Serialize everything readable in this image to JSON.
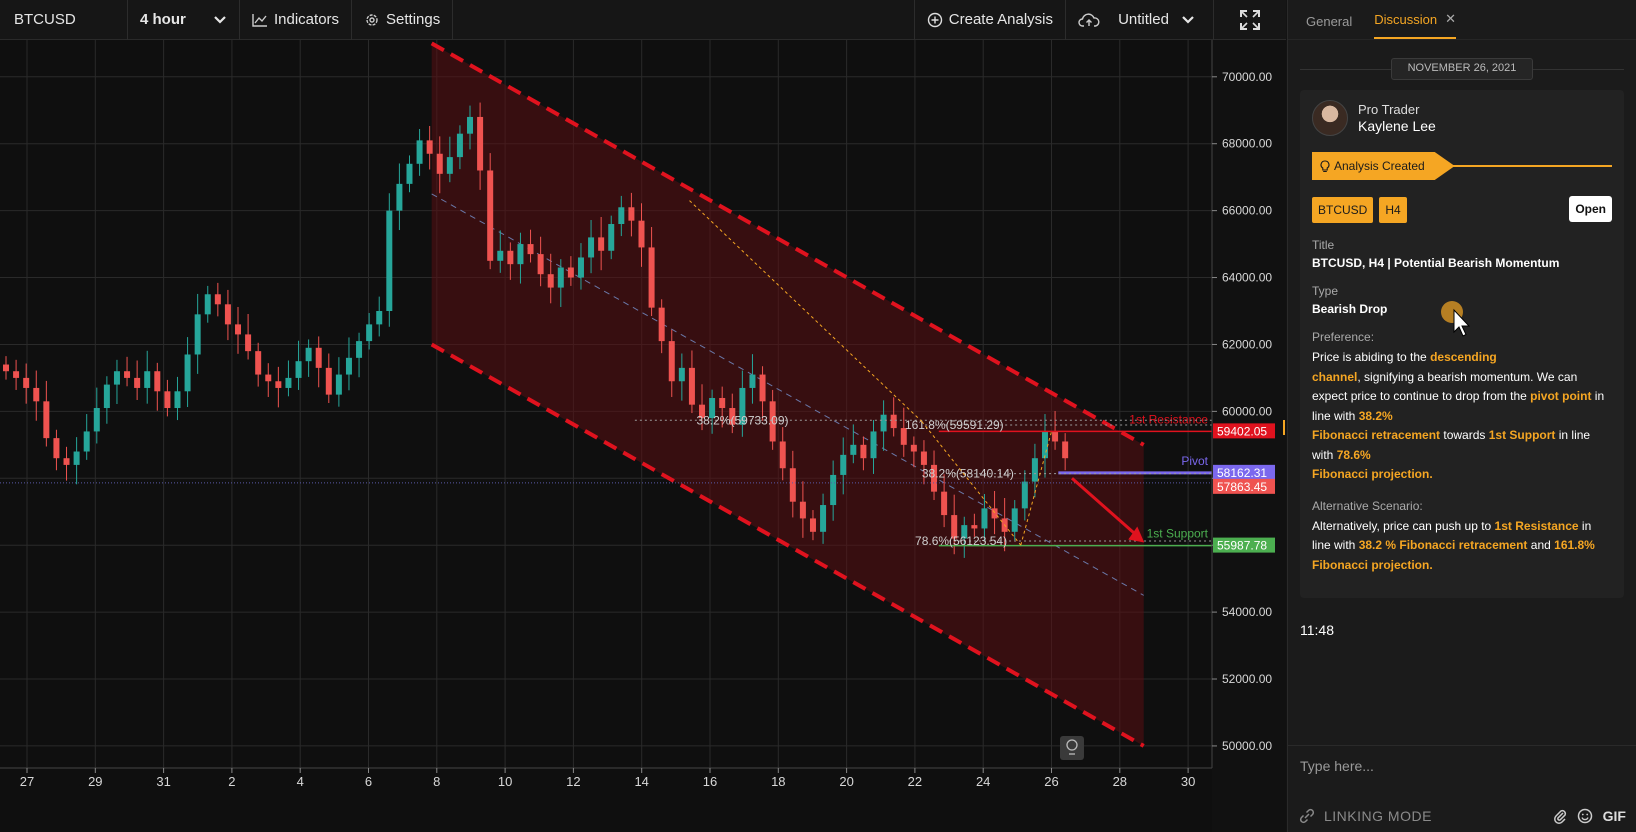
{
  "toolbar": {
    "symbol": "BTCUSD",
    "interval": "4 hour",
    "indicators": "Indicators",
    "settings": "Settings",
    "create_analysis": "Create Analysis",
    "layout_name": "Untitled"
  },
  "icons": {
    "interval_dropdown": "chevron-down-icon",
    "indicators": "line-chart-icon",
    "settings": "gear-icon",
    "create": "plus-circle-icon",
    "cloud": "cloud-upload-icon",
    "layout_dropdown": "chevron-down-icon",
    "fullscreen": "expand-icon",
    "idea": "lightbulb-icon",
    "linking": "link-icon",
    "attach": "paperclip-icon",
    "emoji": "emoji-icon"
  },
  "colors": {
    "accent": "#f5a623",
    "bull": "#26a69a",
    "bear": "#ef5350",
    "channel": "#e0121e",
    "support": "#4caf50",
    "pivot": "#7b68ee"
  },
  "chart_data": {
    "type": "candlestick",
    "x_ticks": [
      "27",
      "29",
      "31",
      "2",
      "4",
      "6",
      "8",
      "10",
      "12",
      "14",
      "16",
      "18",
      "20",
      "22",
      "24",
      "26",
      "28",
      "30"
    ],
    "y_ticks": [
      "70000.00",
      "68000.00",
      "66000.00",
      "64000.00",
      "62000.00",
      "60000.00",
      "58000.00",
      "56000.00",
      "54000.00",
      "52000.00",
      "50000.00"
    ],
    "ylim": [
      49400,
      71100
    ],
    "price_tags": [
      {
        "value": 59402.05,
        "label": "59402.05",
        "color": "#e0121e"
      },
      {
        "value": 58162.31,
        "label": "58162.31",
        "color": "#7b68ee"
      },
      {
        "value": 57863.45,
        "label": "57863.45",
        "color": "#ef5350"
      },
      {
        "value": 55987.78,
        "label": "55987.78",
        "color": "#4caf50"
      }
    ],
    "levels": [
      {
        "name": "1st Resistance",
        "value": 59402.05
      },
      {
        "name": "Pivot",
        "value": 58162.31
      },
      {
        "name": "1st Support",
        "value": 55987.78
      }
    ],
    "fib_labels": [
      {
        "text": "38.2%(59733.09)",
        "value": 59733.09
      },
      {
        "text": "161.8%(59591.29)",
        "value": 59591.29
      },
      {
        "text": "38.2%(58140.14)",
        "value": 58140.14
      },
      {
        "text": "78.6%(56123.54)",
        "value": 56123.54
      }
    ],
    "closes": [
      61200,
      61000,
      60700,
      60300,
      59200,
      58600,
      58400,
      58800,
      59400,
      60100,
      60800,
      61200,
      61000,
      60700,
      61200,
      60600,
      60100,
      60600,
      61700,
      62900,
      63500,
      63200,
      62600,
      62300,
      61800,
      61100,
      60900,
      60700,
      61000,
      61500,
      61900,
      61300,
      60500,
      61100,
      61600,
      62100,
      62600,
      63000,
      66000,
      66800,
      67400,
      68100,
      67700,
      67100,
      67600,
      68300,
      68800,
      67200,
      64500,
      64800,
      64400,
      65000,
      64700,
      64100,
      63700,
      64300,
      64000,
      64600,
      65200,
      64800,
      65600,
      66100,
      65700,
      64900,
      63100,
      62100,
      60900,
      61300,
      60200,
      59800,
      60400,
      60100,
      59600,
      60700,
      61100,
      60300,
      59100,
      58300,
      57300,
      56800,
      56400,
      57200,
      58100,
      58700,
      59000,
      58600,
      59400,
      59900,
      59500,
      59000,
      58800,
      58400,
      57600,
      56900,
      56200,
      56600,
      56500,
      57100,
      56800,
      56400,
      57100,
      57900,
      58600,
      59400,
      59100,
      58600
    ]
  },
  "panel": {
    "tabs": {
      "general": "General",
      "discussion": "Discussion"
    },
    "date": "NOVEMBER 26, 2021",
    "author_role": "Pro Trader",
    "author_name": "Kaylene Lee",
    "analysis_badge": "Analysis Created",
    "tag_symbol": "BTCUSD",
    "tag_interval": "H4",
    "open": "Open",
    "title_label": "Title",
    "title_value": "BTCUSD, H4 | Potential Bearish Momentum",
    "type_label": "Type",
    "type_value": "Bearish Drop",
    "preference_label": "Preference:",
    "pref": {
      "p1": "Price is abiding to the ",
      "h1": "descending",
      "h2": "channel",
      "p2": ", signifying a bearish momentum. We can expect price to continue to drop from the ",
      "h3": "pivot point",
      "p3": " in line with ",
      "h4": "38.2%",
      "h5": "Fibonacci retracement",
      "p4": " towards ",
      "h6": "1st Support",
      "p5": " in line with ",
      "h7": "78.6%",
      "h8": "Fibonacci projection."
    },
    "alt_label": "Alternative Scenario:",
    "alt": {
      "p1": "Alternatively, price can push up to ",
      "h1": "1st Resistance",
      "p2": " in line with ",
      "h2": "38.2 % Fibonacci retracement",
      "p3": " and ",
      "h3": "161.8% Fibonacci projection."
    },
    "time": "11:48",
    "input_placeholder": "Type here...",
    "linking_mode": "LINKING MODE",
    "gif": "GIF"
  }
}
